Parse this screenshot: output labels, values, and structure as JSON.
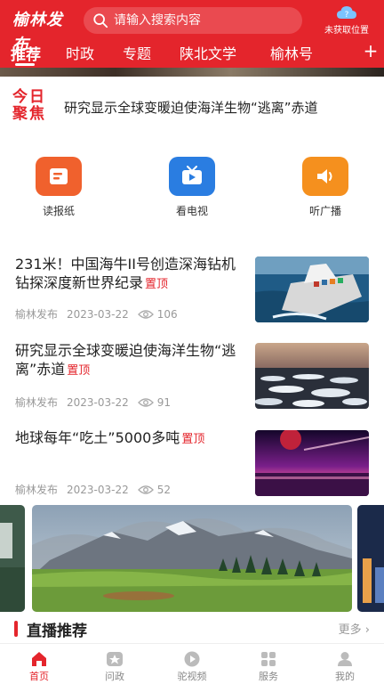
{
  "header": {
    "logo": "榆林发布",
    "search_placeholder": "请输入搜索内容",
    "location_label": "未获取位置",
    "tabs": [
      "推荐",
      "时政",
      "专题",
      "陕北文学",
      "榆林号"
    ],
    "more_tab_glyph": "+"
  },
  "focus": {
    "badge_line1": "今日",
    "badge_line2": "聚焦",
    "headline": "研究显示全球变暖迫使海洋生物“逃离”赤道"
  },
  "services": [
    {
      "label": "读报纸",
      "icon": "newspaper-icon",
      "color": "#f0612d"
    },
    {
      "label": "看电视",
      "icon": "tv-icon",
      "color": "#2a7de1"
    },
    {
      "label": "听广播",
      "icon": "radio-speaker-icon",
      "color": "#f5901e"
    }
  ],
  "news": [
    {
      "title": "231米！中国海牛II号创造深海钻机钻探深度新世界纪录",
      "pin": "置顶",
      "source": "榆林发布",
      "date": "2023-03-22",
      "views": "106",
      "thumb": "ship-image"
    },
    {
      "title": "研究显示全球变暖迫使海洋生物“逃离”赤道",
      "pin": "置顶",
      "source": "榆林发布",
      "date": "2023-03-22",
      "views": "91",
      "thumb": "ice-sea-image"
    },
    {
      "title": "地球每年“吃土”5000多吨",
      "pin": "置顶",
      "source": "榆林发布",
      "date": "2023-03-22",
      "views": "52",
      "thumb": "planet-sunset-image"
    }
  ],
  "live": {
    "title": "直播推荐",
    "more": "更多 ›"
  },
  "bottom_nav": [
    {
      "label": "首页",
      "icon": "home-icon",
      "active": true
    },
    {
      "label": "问政",
      "icon": "question-star-icon",
      "active": false
    },
    {
      "label": "驼视频",
      "icon": "video-play-icon",
      "active": false
    },
    {
      "label": "服务",
      "icon": "grid-icon",
      "active": false
    },
    {
      "label": "我的",
      "icon": "user-icon",
      "active": false
    }
  ],
  "colors": {
    "brand": "#e4252c",
    "pin": "#e4252c",
    "meta": "#999999"
  }
}
